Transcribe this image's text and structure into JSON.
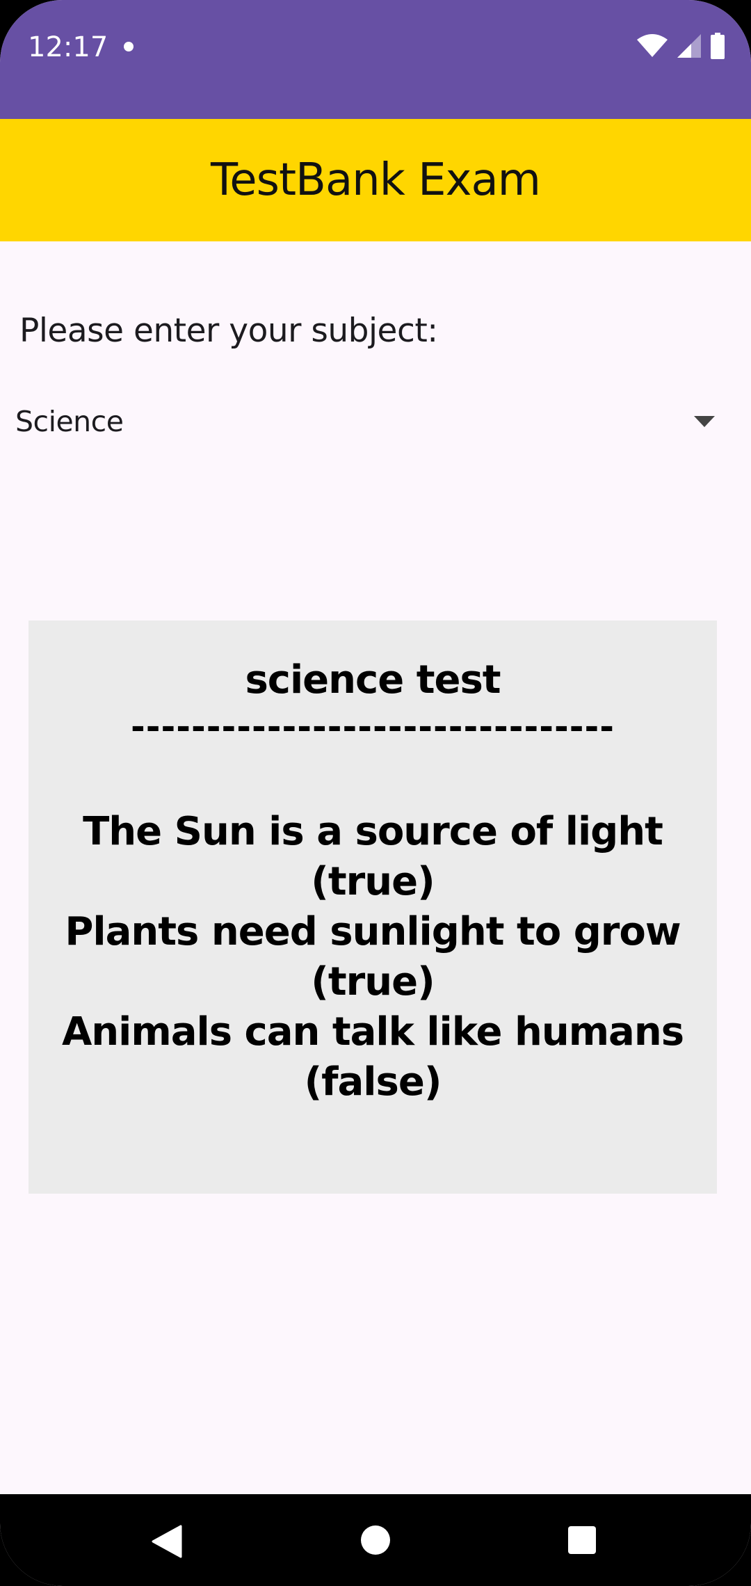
{
  "status_bar": {
    "time": "12:17",
    "icons": [
      "notification-dot-icon",
      "wifi-icon",
      "cell-signal-icon",
      "battery-icon"
    ]
  },
  "app_bar": {
    "title": "TestBank Exam"
  },
  "form": {
    "subject_label": "Please enter your subject:",
    "subject_selected": "Science"
  },
  "test": {
    "title": "science test",
    "divider": "--------------------------------",
    "questions": [
      {
        "statement": "The Sun is a source of light",
        "answer": "(true)"
      },
      {
        "statement": "Plants need sunlight to grow",
        "answer": "(true)"
      },
      {
        "statement": "Animals can talk like humans",
        "answer": "(false)"
      }
    ]
  },
  "nav_bar": {
    "icons": [
      "back-icon",
      "home-icon",
      "recents-icon"
    ]
  },
  "colors": {
    "status_bar": "#6750A4",
    "app_bar": "#FFD600",
    "background": "#FDF7FD",
    "card": "#EBEBEB"
  }
}
